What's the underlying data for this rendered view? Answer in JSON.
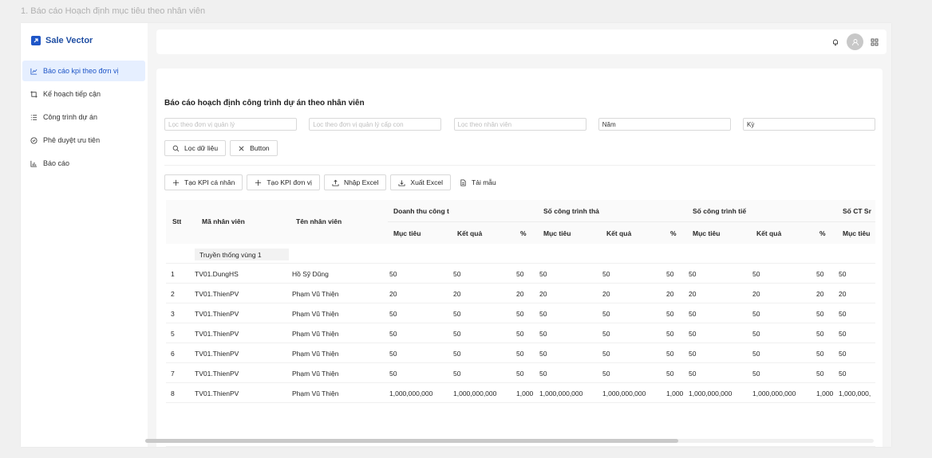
{
  "caption": "1. Báo cáo Hoạch định mục tiêu theo nhân viên",
  "app": {
    "name": "Sale Vector"
  },
  "sidebar": {
    "items": [
      {
        "label": "Báo cáo kpi theo đơn vị",
        "icon": "line-chart-icon",
        "active": true
      },
      {
        "label": "Kế hoạch tiếp cận",
        "icon": "crop-icon",
        "active": false
      },
      {
        "label": "Công trình dự án",
        "icon": "list-icon",
        "active": false
      },
      {
        "label": "Phê duyệt ưu tiên",
        "icon": "check-circle-icon",
        "active": false
      },
      {
        "label": "Báo cáo",
        "icon": "bar-chart-icon",
        "active": false
      }
    ]
  },
  "topbar": {
    "icons": [
      "bell-icon",
      "avatar-user-icon",
      "apps-grid-icon"
    ]
  },
  "page": {
    "title": "Báo cáo hoạch định công trình dự án theo nhân viên",
    "filters": {
      "unit_placeholder": "Lọc theo đơn vị quản lý",
      "subunit_placeholder": "Lọc theo đơn vị quản lý cấp con",
      "employee_placeholder": "Lọc theo nhân viên",
      "year_value": "Năm",
      "period_value": "Kỳ"
    },
    "buttons": {
      "filter_label": "Lọc dữ liệu",
      "clear_label": "Button",
      "create_personal_kpi": "Tạo KPI cá nhân",
      "create_unit_kpi": "Tạo KPI đơn vị",
      "import_excel": "Nhập Excel",
      "export_excel": "Xuất Excel",
      "template": "Tải mẫu"
    }
  },
  "table": {
    "columns": {
      "stt": "Stt",
      "code": "Mã nhân viên",
      "name": "Tên nhân viên"
    },
    "groups": [
      "Doanh thu công t",
      "Số công trình thả",
      "Số công trình tiế",
      "Số CT Sr"
    ],
    "sub_headers": [
      "Mục tiêu",
      "Kết quả",
      "%"
    ],
    "group_label": "Truyền thống vùng 1",
    "rows": [
      {
        "stt": "1",
        "code": "TV01.DungHS",
        "name": "Hồ Sỹ Dũng",
        "v": [
          "50",
          "50",
          "50",
          "50",
          "50",
          "50",
          "50",
          "50",
          "50",
          "50"
        ]
      },
      {
        "stt": "2",
        "code": "TV01.ThienPV",
        "name": "Phạm Vũ Thiện",
        "v": [
          "20",
          "20",
          "20",
          "20",
          "20",
          "20",
          "20",
          "20",
          "20",
          "20"
        ]
      },
      {
        "stt": "3",
        "code": "TV01.ThienPV",
        "name": "Phạm Vũ Thiện",
        "v": [
          "50",
          "50",
          "50",
          "50",
          "50",
          "50",
          "50",
          "50",
          "50",
          "50"
        ]
      },
      {
        "stt": "5",
        "code": "TV01.ThienPV",
        "name": "Phạm Vũ Thiện",
        "v": [
          "50",
          "50",
          "50",
          "50",
          "50",
          "50",
          "50",
          "50",
          "50",
          "50"
        ]
      },
      {
        "stt": "6",
        "code": "TV01.ThienPV",
        "name": "Phạm Vũ Thiện",
        "v": [
          "50",
          "50",
          "50",
          "50",
          "50",
          "50",
          "50",
          "50",
          "50",
          "50"
        ]
      },
      {
        "stt": "7",
        "code": "TV01.ThienPV",
        "name": "Phạm Vũ Thiện",
        "v": [
          "50",
          "50",
          "50",
          "50",
          "50",
          "50",
          "50",
          "50",
          "50",
          "50"
        ]
      },
      {
        "stt": "8",
        "code": "TV01.ThienPV",
        "name": "Phạm Vũ Thiện",
        "v": [
          "1,000,000,000",
          "1,000,000,000",
          "1,000",
          "1,000,000,000",
          "1,000,000,000",
          "1,000",
          "1,000,000,000",
          "1,000,000,000",
          "1,000",
          "1,000,000,"
        ]
      }
    ]
  },
  "colors": {
    "accent": "#1f56c7",
    "active_bg": "#e6efff"
  }
}
